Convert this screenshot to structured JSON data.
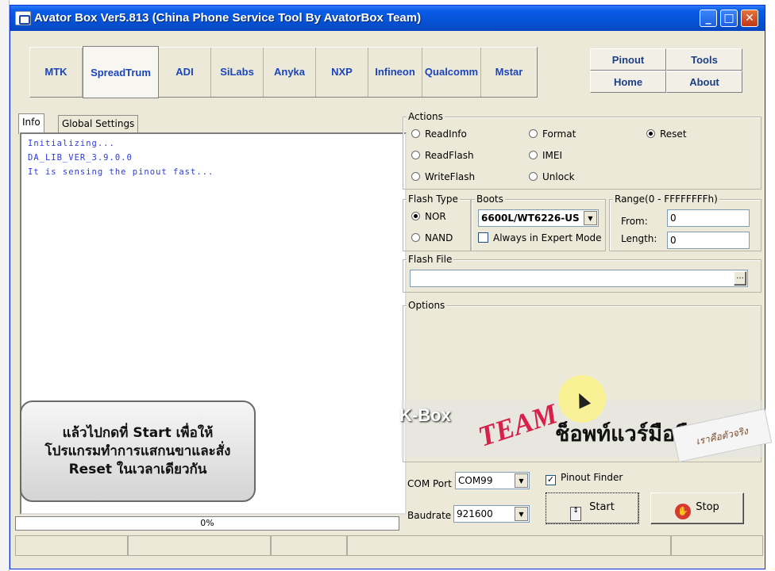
{
  "window": {
    "title": "Avator Box Ver5.813 (China Phone Service Tool By AvatorBox Team)",
    "controls": {
      "minimize": "_",
      "maximize": "□",
      "close": "✕"
    }
  },
  "vendor_tabs": [
    "MTK",
    "SpreadTrum",
    "ADI",
    "SiLabs",
    "Anyka",
    "NXP",
    "Infineon",
    "Qualcomm",
    "Mstar"
  ],
  "active_vendor": "SpreadTrum",
  "top_buttons": {
    "pinout": "Pinout",
    "tools": "Tools",
    "home": "Home",
    "about": "About"
  },
  "info_tabs": {
    "info": "Info",
    "global": "Global Settings"
  },
  "log_lines": [
    "Initializing...",
    "DA_LIB_VER_3.9.0.0",
    "It is sensing the pinout fast..."
  ],
  "overlay_text": [
    "แล้วไปกดที่ Start เพื่อให้",
    "โปรแกรมทำการแสกนขาและสั่ง",
    "Reset ในเวลาเดียวกัน"
  ],
  "progress": {
    "text": "0%",
    "value": 0
  },
  "actions": {
    "label": "Actions",
    "options": [
      "ReadInfo",
      "Format",
      "Reset",
      "ReadFlash",
      "IMEI",
      "WriteFlash",
      "Unlock"
    ],
    "selected": "Reset"
  },
  "flash_type": {
    "label": "Flash Type",
    "options": [
      "NOR",
      "NAND"
    ],
    "selected": "NOR"
  },
  "boots": {
    "label": "Boots",
    "value": "6600L/WT6226-US",
    "expert_label": "Always in Expert Mode",
    "expert_checked": false
  },
  "range": {
    "label": "Range(0 - FFFFFFFFh)",
    "from_label": "From:",
    "from_value": "0",
    "length_label": "Length:",
    "length_value": "0"
  },
  "flash_file": {
    "label": "Flash File",
    "value": "",
    "browse": "..."
  },
  "options_group": {
    "label": "Options"
  },
  "com_port": {
    "label": "COM Port",
    "value": "COM99"
  },
  "baudrate": {
    "label": "Baudrate",
    "value": "921600"
  },
  "pinout_finder": {
    "label": "Pinout Finder",
    "checked": true
  },
  "start_button": "Start",
  "stop_button": "Stop",
  "watermark": {
    "kbox": "K-Box",
    "team": "TEAM",
    "shop": "ช็อพท์แวร์มือถือ",
    "tag": "เราคือตัวจริง"
  },
  "colors": {
    "titlebar": "#0553d6",
    "vendor_tab_text": "#1c45b8",
    "log_text": "#2e3ae0",
    "window_bg": "#ece9d8"
  }
}
